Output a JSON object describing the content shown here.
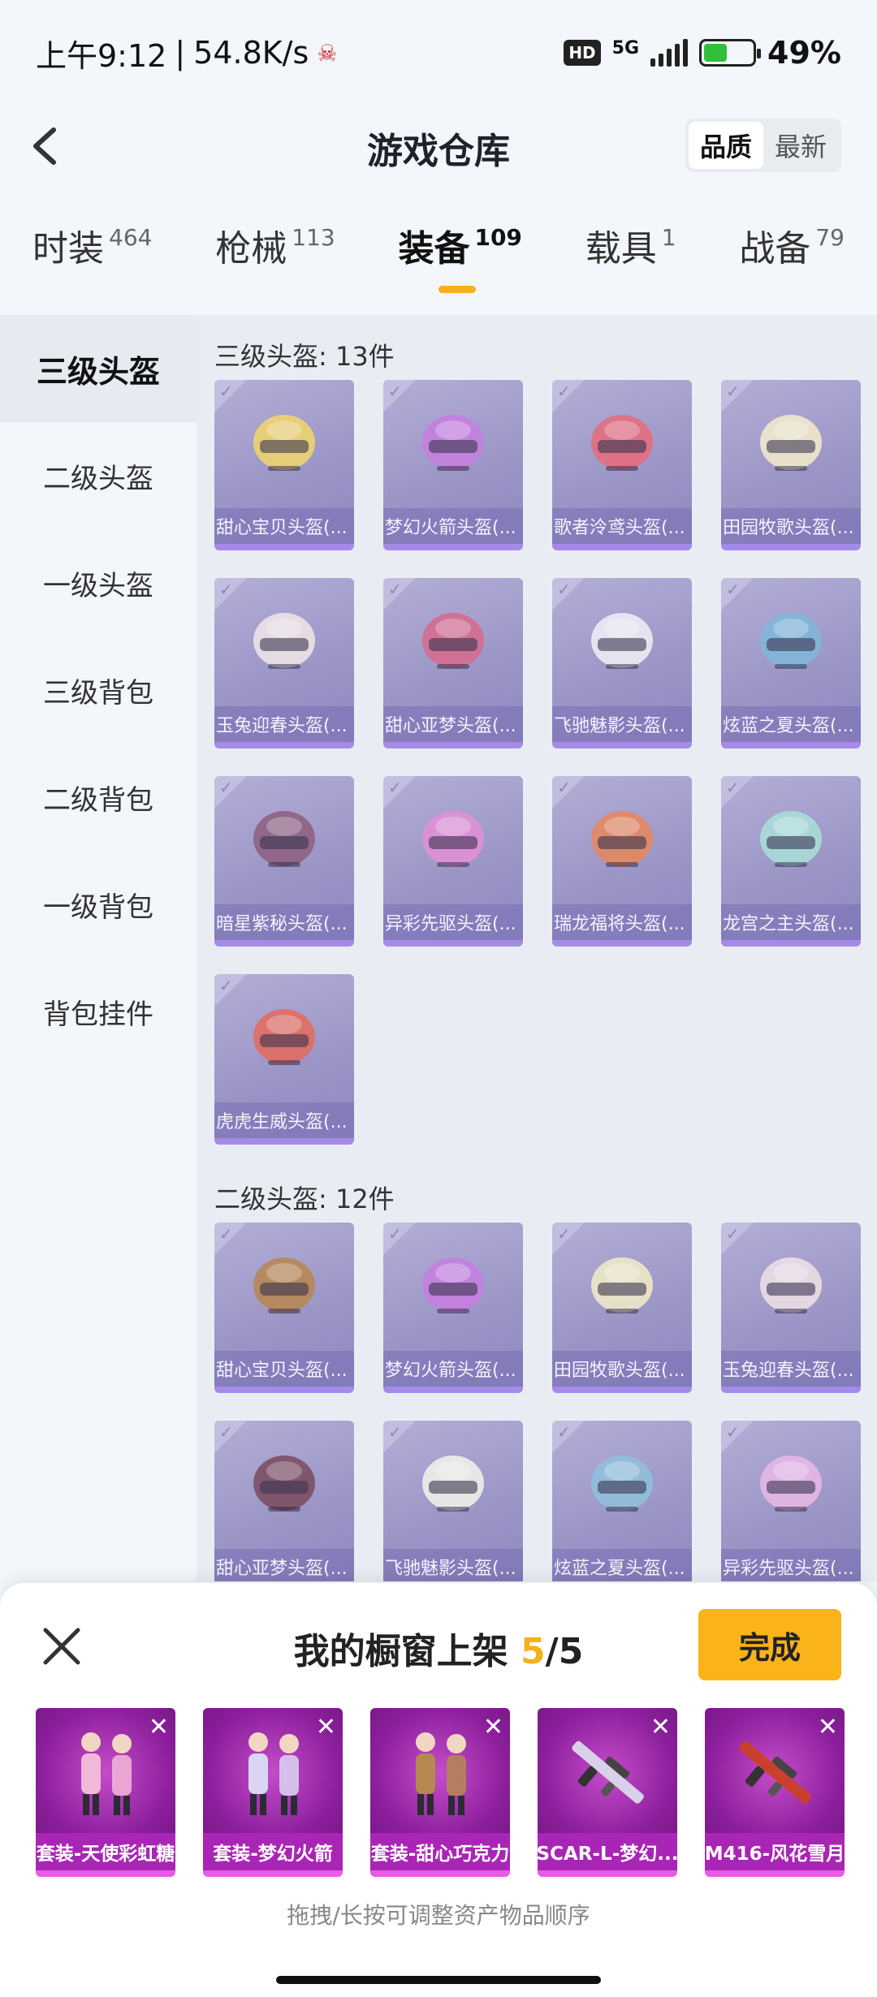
{
  "status": {
    "time": "上午9:12",
    "speed": "54.8K/s",
    "network": "5G",
    "hd": "HD",
    "battery": "49%"
  },
  "header": {
    "title": "游戏仓库",
    "sort_options": [
      "品质",
      "最新"
    ]
  },
  "tabs": [
    {
      "label": "时装",
      "count": "464"
    },
    {
      "label": "枪械",
      "count": "113"
    },
    {
      "label": "装备",
      "count": "109"
    },
    {
      "label": "载具",
      "count": "1"
    },
    {
      "label": "战备",
      "count": "79"
    }
  ],
  "sidebar": [
    "三级头盔",
    "二级头盔",
    "一级头盔",
    "三级背包",
    "二级背包",
    "一级背包",
    "背包挂件"
  ],
  "groups": [
    {
      "title": "三级头盔: 13件",
      "items": [
        {
          "name": "甜心宝贝头盔(...",
          "color": "#f2d66a"
        },
        {
          "name": "梦幻火箭头盔(...",
          "color": "#c77ee0"
        },
        {
          "name": "歌者泠鸢头盔(...",
          "color": "#e86a7a"
        },
        {
          "name": "田园牧歌头盔(...",
          "color": "#f4eccb"
        },
        {
          "name": "玉兔迎春头盔(...",
          "color": "#f1e6e6"
        },
        {
          "name": "甜心亚梦头盔(...",
          "color": "#d66a8c"
        },
        {
          "name": "飞驰魅影头盔(...",
          "color": "#f0f0f6"
        },
        {
          "name": "炫蓝之夏头盔(...",
          "color": "#7fb7d8"
        },
        {
          "name": "暗星紫秘头盔(...",
          "color": "#8d5e7c"
        },
        {
          "name": "异彩先驱头盔(...",
          "color": "#e48fd6"
        },
        {
          "name": "瑞龙福将头盔(...",
          "color": "#e8875a"
        },
        {
          "name": "龙宫之主头盔(...",
          "color": "#a9e0d8"
        },
        {
          "name": "虎虎生威头盔(...",
          "color": "#e56a5a"
        }
      ]
    },
    {
      "title": "二级头盔: 12件",
      "items": [
        {
          "name": "甜心宝贝头盔(...",
          "color": "#b8864e"
        },
        {
          "name": "梦幻火箭头盔(...",
          "color": "#c77ee0"
        },
        {
          "name": "田园牧歌头盔(...",
          "color": "#f3ecc8"
        },
        {
          "name": "玉兔迎春头盔(...",
          "color": "#f0e2e6"
        },
        {
          "name": "甜心亚梦头盔(...",
          "color": "#7a4a5c"
        },
        {
          "name": "飞驰魅影头盔(...",
          "color": "#f5f3ea"
        },
        {
          "name": "炫蓝之夏头盔(...",
          "color": "#8fc1dc"
        },
        {
          "name": "异彩先驱头盔(...",
          "color": "#e9b8e8"
        }
      ]
    }
  ],
  "sheet": {
    "title_prefix": "我的橱窗上架 ",
    "count": "5",
    "total": "/5",
    "done": "完成",
    "hint": "拖拽/长按可调整资产物品顺序",
    "items": [
      {
        "name": "套装-天使彩虹糖",
        "color": "#f2b8d8"
      },
      {
        "name": "套装-梦幻火箭",
        "color": "#d9d6f4"
      },
      {
        "name": "套装-甜心巧克力",
        "color": "#b58a4e"
      },
      {
        "name": "SCAR-L-梦幻...",
        "color": "#d7d1ea"
      },
      {
        "name": "M416-风花雪月",
        "color": "#c9412e"
      }
    ]
  },
  "icons": {
    "back": "back-arrow-icon",
    "close": "close-icon",
    "remove": "remove-x-icon",
    "check": "check-icon"
  }
}
